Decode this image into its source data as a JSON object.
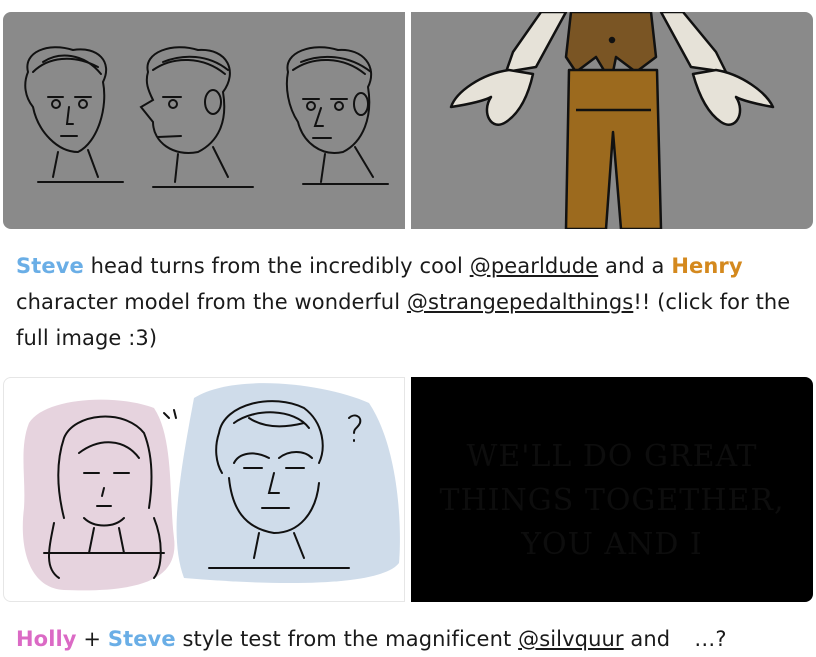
{
  "post1": {
    "caption": {
      "name1": "Steve",
      "text1": " head turns from the incredibly cool ",
      "mention1": "@pearldude",
      "text2": " and a ",
      "name2": "Henry",
      "text3": " character model from the wonderful ",
      "mention2": "@strangepedalthings",
      "text4": "!! (click for the full image :3)"
    }
  },
  "post2": {
    "quote_lines": [
      "WE'LL DO GREAT",
      "THINGS TOGETHER,",
      "YOU AND I"
    ],
    "caption": {
      "name1": "Holly",
      "text1": " + ",
      "name2": "Steve",
      "text2": " style test from the magnificent ",
      "mention1": "@silvquur",
      "text3": " and",
      "text4": "…?"
    }
  },
  "colors": {
    "steve": "#6aaee6",
    "henry": "#d4891e",
    "holly": "#db6ac5",
    "canvas_gray": "#8a8a8a"
  }
}
